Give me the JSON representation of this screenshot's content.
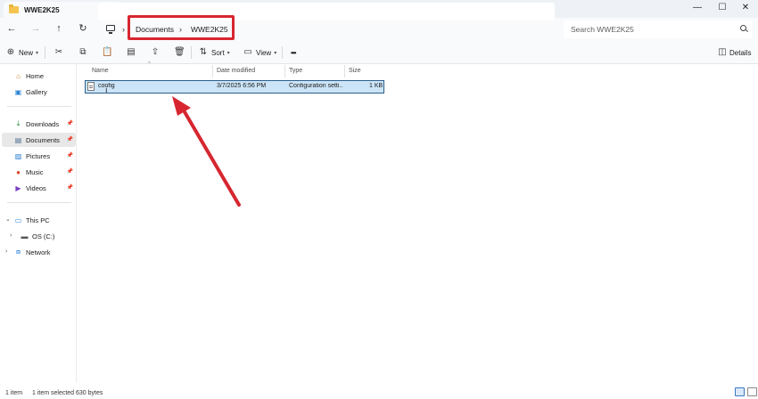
{
  "tab": {
    "title": "WWE2K25",
    "close": "✕",
    "new_tab": "+"
  },
  "window_controls": {
    "minimize": "—",
    "maximize": "☐",
    "close": "✕"
  },
  "nav": {
    "back": "←",
    "forward": "→",
    "up": "↑",
    "refresh": "↻"
  },
  "breadcrumb": {
    "separator": "›",
    "items": [
      "Documents",
      "WWE2K25"
    ]
  },
  "search": {
    "placeholder": "Search WWE2K25"
  },
  "toolbar": {
    "new_label": "New",
    "sort_label": "Sort",
    "view_label": "View",
    "more_label": "•••",
    "details_label": "Details"
  },
  "sidebar": {
    "quick": [
      {
        "label": "Home",
        "icon": "home-icon"
      },
      {
        "label": "Gallery",
        "icon": "gallery-icon"
      }
    ],
    "pinned": [
      {
        "label": "Downloads",
        "icon": "download-icon"
      },
      {
        "label": "Documents",
        "icon": "documents-icon",
        "active": true
      },
      {
        "label": "Pictures",
        "icon": "pictures-icon"
      },
      {
        "label": "Music",
        "icon": "music-icon"
      },
      {
        "label": "Videos",
        "icon": "videos-icon"
      }
    ],
    "tree": [
      {
        "label": "This PC",
        "icon": "this-pc-icon"
      },
      {
        "label": "OS (C:)",
        "icon": "drive-icon"
      },
      {
        "label": "Network",
        "icon": "network-icon"
      }
    ]
  },
  "columns": [
    "Name",
    "Date modified",
    "Type",
    "Size"
  ],
  "files": [
    {
      "name": "config",
      "date": "3/7/2025 6:56 PM",
      "type": "Configuration setti...",
      "size": "1 KB"
    }
  ],
  "status": {
    "count": "1 item",
    "selected": "1 item selected  630 bytes"
  },
  "colors": {
    "highlight": "#d7262f",
    "selection": "#cce4f7",
    "arrow": "#d7262f"
  }
}
